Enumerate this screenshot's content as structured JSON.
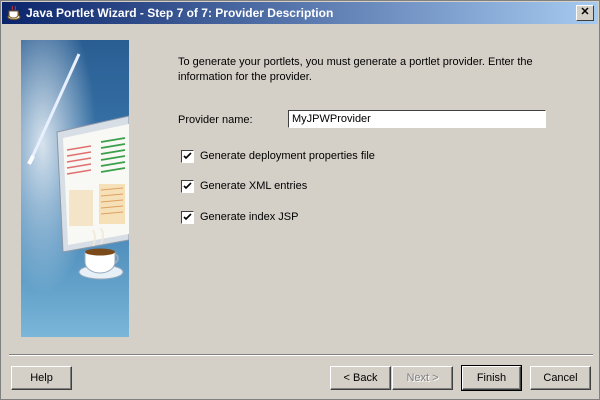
{
  "window": {
    "title": "Java Portlet Wizard - Step 7 of 7: Provider Description",
    "close_label": "✕"
  },
  "content": {
    "instructions": "To generate your portlets, you must generate a portlet provider. Enter the information for the provider.",
    "provider_name_label": "Provider name:",
    "provider_name_value": "MyJPWProvider",
    "options": [
      {
        "label": "Generate deployment properties file",
        "checked": true
      },
      {
        "label": "Generate XML entries",
        "checked": true
      },
      {
        "label": "Generate index JSP",
        "checked": true
      }
    ]
  },
  "buttons": {
    "help": "Help",
    "back": "< Back",
    "next": "Next >",
    "finish": "Finish",
    "cancel": "Cancel"
  },
  "icons": [
    "coffee-cup-app-icon",
    "close-icon",
    "checkmark-icon",
    "wizard-banner-illustration"
  ]
}
